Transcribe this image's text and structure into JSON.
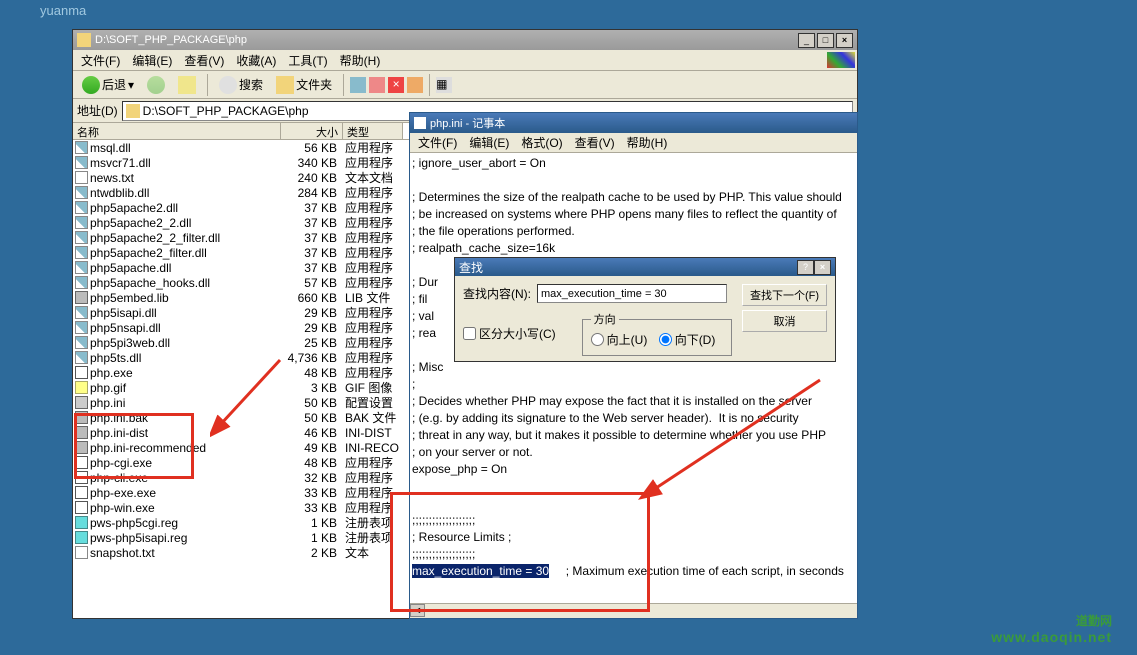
{
  "watermark": "yuanma",
  "explorer": {
    "title": "D:\\SOFT_PHP_PACKAGE\\php",
    "menu": [
      "文件(F)",
      "编辑(E)",
      "查看(V)",
      "收藏(A)",
      "工具(T)",
      "帮助(H)"
    ],
    "toolbar": {
      "back": "后退",
      "search": "搜索",
      "folders": "文件夹"
    },
    "addr_label": "地址(D)",
    "addr_path": "D:\\SOFT_PHP_PACKAGE\\php",
    "cols": {
      "name": "名称",
      "size": "大小",
      "type": "类型"
    },
    "files": [
      {
        "icon": "dll",
        "name": "msql.dll",
        "size": "56 KB",
        "type": "应用程序"
      },
      {
        "icon": "dll",
        "name": "msvcr71.dll",
        "size": "340 KB",
        "type": "应用程序"
      },
      {
        "icon": "txt",
        "name": "news.txt",
        "size": "240 KB",
        "type": "文本文档"
      },
      {
        "icon": "dll",
        "name": "ntwdblib.dll",
        "size": "284 KB",
        "type": "应用程序"
      },
      {
        "icon": "dll",
        "name": "php5apache2.dll",
        "size": "37 KB",
        "type": "应用程序"
      },
      {
        "icon": "dll",
        "name": "php5apache2_2.dll",
        "size": "37 KB",
        "type": "应用程序"
      },
      {
        "icon": "dll",
        "name": "php5apache2_2_filter.dll",
        "size": "37 KB",
        "type": "应用程序"
      },
      {
        "icon": "dll",
        "name": "php5apache2_filter.dll",
        "size": "37 KB",
        "type": "应用程序"
      },
      {
        "icon": "dll",
        "name": "php5apache.dll",
        "size": "37 KB",
        "type": "应用程序"
      },
      {
        "icon": "dll",
        "name": "php5apache_hooks.dll",
        "size": "57 KB",
        "type": "应用程序"
      },
      {
        "icon": "lib",
        "name": "php5embed.lib",
        "size": "660 KB",
        "type": "LIB 文件"
      },
      {
        "icon": "dll",
        "name": "php5isapi.dll",
        "size": "29 KB",
        "type": "应用程序"
      },
      {
        "icon": "dll",
        "name": "php5nsapi.dll",
        "size": "29 KB",
        "type": "应用程序"
      },
      {
        "icon": "dll",
        "name": "php5pi3web.dll",
        "size": "25 KB",
        "type": "应用程序"
      },
      {
        "icon": "dll",
        "name": "php5ts.dll",
        "size": "4,736 KB",
        "type": "应用程序"
      },
      {
        "icon": "exe",
        "name": "php.exe",
        "size": "48 KB",
        "type": "应用程序"
      },
      {
        "icon": "gif",
        "name": "php.gif",
        "size": "3 KB",
        "type": "GIF 图像"
      },
      {
        "icon": "ini",
        "name": "php.ini",
        "size": "50 KB",
        "type": "配置设置"
      },
      {
        "icon": "lib",
        "name": "php.ini.bak",
        "size": "50 KB",
        "type": "BAK 文件"
      },
      {
        "icon": "lib",
        "name": "php.ini-dist",
        "size": "46 KB",
        "type": "INI-DIST"
      },
      {
        "icon": "lib",
        "name": "php.ini-recommended",
        "size": "49 KB",
        "type": "INI-RECO"
      },
      {
        "icon": "exe",
        "name": "php-cgi.exe",
        "size": "48 KB",
        "type": "应用程序"
      },
      {
        "icon": "exe",
        "name": "php-cli.exe",
        "size": "32 KB",
        "type": "应用程序"
      },
      {
        "icon": "exe",
        "name": "php-exe.exe",
        "size": "33 KB",
        "type": "应用程序"
      },
      {
        "icon": "exe",
        "name": "php-win.exe",
        "size": "33 KB",
        "type": "应用程序"
      },
      {
        "icon": "reg",
        "name": "pws-php5cgi.reg",
        "size": "1 KB",
        "type": "注册表项"
      },
      {
        "icon": "reg",
        "name": "pws-php5isapi.reg",
        "size": "1 KB",
        "type": "注册表项"
      },
      {
        "icon": "txt",
        "name": "snapshot.txt",
        "size": "2 KB",
        "type": "文本"
      }
    ]
  },
  "notepad": {
    "title": "php.ini - 记事本",
    "menu": [
      "文件(F)",
      "编辑(E)",
      "格式(O)",
      "查看(V)",
      "帮助(H)"
    ],
    "lines_top": "; ignore_user_abort = On\n\n; Determines the size of the realpath cache to be used by PHP. This value should\n; be increased on systems where PHP opens many files to reflect the quantity of\n; the file operations performed.\n; realpath_cache_size=16k\n\n; Dur                                                               path information for a given\n; fil                                                               files, consider increasing this\n; val\n; rea\n\n; Misc\n;\n; Decides whether PHP may expose the fact that it is installed on the server\n; (e.g. by adding its signature to the Web server header).  It is no security\n; threat in any way, but it makes it possible to determine whether you use PHP\n; on your server or not.\nexpose_php = On\n\n\n;;;;;;;;;;;;;;;;;;;\n; Resource Limits ;\n;;;;;;;;;;;;;;;;;;;\n",
    "hl_line": "max_execution_time = 30",
    "after_hl": "     ; Maximum execution time of each script, in seconds"
  },
  "find": {
    "title": "查找",
    "label": "查找内容(N):",
    "value": "max_execution_time = 30",
    "case": "区分大小写(C)",
    "dir_legend": "方向",
    "up": "向上(U)",
    "down": "向下(D)",
    "next": "查找下一个(F)",
    "cancel": "取消"
  },
  "logo": {
    "brand": "道勤网",
    "url": "www.daoqin.net"
  }
}
